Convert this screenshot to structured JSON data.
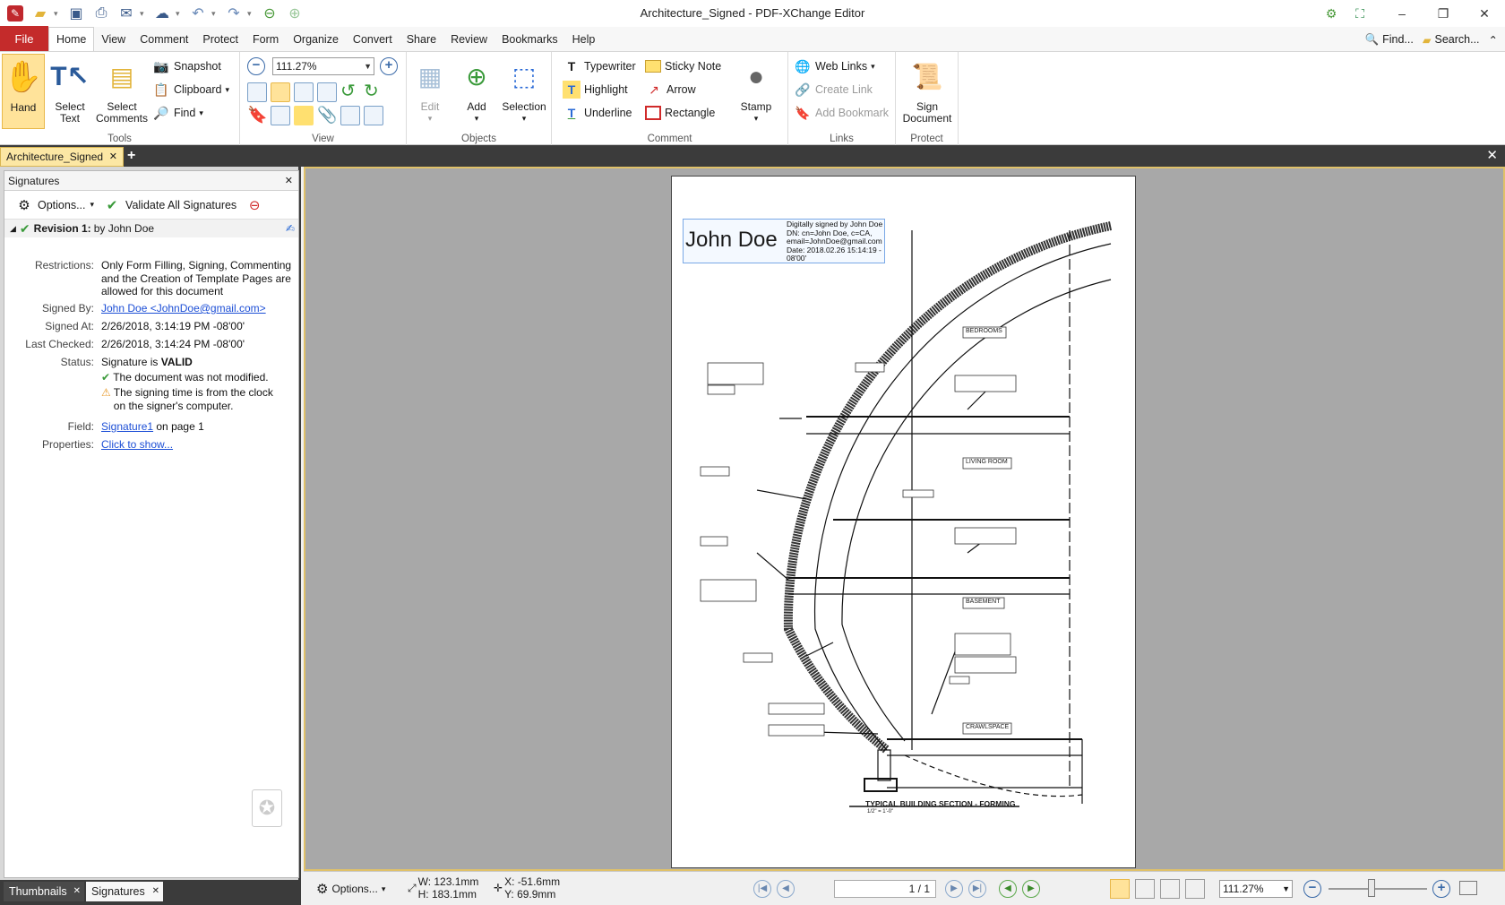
{
  "window": {
    "title": "Architecture_Signed - PDF-XChange Editor",
    "minimize": "–",
    "restore": "❐",
    "close": "✕"
  },
  "menu": {
    "file": "File",
    "tabs": [
      "Home",
      "View",
      "Comment",
      "Protect",
      "Form",
      "Organize",
      "Convert",
      "Share",
      "Review",
      "Bookmarks",
      "Help"
    ],
    "find": "Find...",
    "search": "Search..."
  },
  "ribbon": {
    "tools": {
      "label": "Tools",
      "hand": "Hand",
      "select_text": [
        "Select",
        "Text"
      ],
      "select_comments": [
        "Select",
        "Comments"
      ],
      "snapshot": "Snapshot",
      "clipboard": "Clipboard",
      "find": "Find"
    },
    "view": {
      "label": "View",
      "zoom": "111.27%"
    },
    "objects": {
      "label": "Objects",
      "edit": "Edit",
      "add": "Add",
      "selection": "Selection"
    },
    "comment": {
      "label": "Comment",
      "typewriter": "Typewriter",
      "sticky_note": "Sticky Note",
      "highlight": "Highlight",
      "arrow": "Arrow",
      "underline": "Underline",
      "rectangle": "Rectangle",
      "stamp": "Stamp"
    },
    "links": {
      "label": "Links",
      "web_links": "Web Links",
      "create_link": "Create Link",
      "add_bookmark": "Add Bookmark"
    },
    "protect": {
      "label": "Protect",
      "sign_document": [
        "Sign",
        "Document"
      ]
    }
  },
  "doc_tab": {
    "name": "Architecture_Signed"
  },
  "signatures_panel": {
    "title": "Signatures",
    "options": "Options...",
    "validate_all": "Validate All Signatures",
    "revision_label": "Revision 1:",
    "revision_by": "by John Doe",
    "restrictions_label": "Restrictions:",
    "restrictions_value": [
      "Only Form Filling, Signing, Commenting",
      "and the Creation of Template Pages are",
      "allowed for this document"
    ],
    "signed_by_label": "Signed By:",
    "signed_by_value": "John Doe <JohnDoe@gmail.com>",
    "signed_at_label": "Signed At:",
    "signed_at_value": "2/26/2018, 3:14:19 PM -08'00'",
    "last_checked_label": "Last Checked:",
    "last_checked_value": "2/26/2018, 3:14:24 PM -08'00'",
    "status_label": "Status:",
    "status_prefix": "Signature is ",
    "status_value": "VALID",
    "status_note1": "The document was not modified.",
    "status_note2": [
      "The signing time is from the clock",
      "on the signer's computer."
    ],
    "field_label": "Field:",
    "field_value": "Signature1",
    "field_suffix": " on page 1",
    "properties_label": "Properties:",
    "properties_value": "Click to show..."
  },
  "bottom_tabs": {
    "thumbnails": "Thumbnails",
    "signatures": "Signatures"
  },
  "document": {
    "signature": {
      "name": "John Doe",
      "info": [
        "Digitally signed by John Doe",
        "DN: cn=John Doe, c=CA,",
        "email=JohnDoe@gmail.com",
        "Date: 2018.02.26 15:14:19 -",
        "08'00'"
      ]
    },
    "drawing": {
      "rooms": [
        "BEDROOMS",
        "LIVING ROOM",
        "BASEMENT",
        "CRAWLSPACE"
      ],
      "title": "TYPICAL BUILDING SECTION - FORMING",
      "scale": "1/2\" = 1'-0\""
    }
  },
  "statusbar": {
    "options": "Options...",
    "w": "W: 123.1mm",
    "h": "H: 183.1mm",
    "x": "X:  -51.6mm",
    "y": "Y:   69.9mm",
    "page": "1 / 1",
    "zoom": "111.27%"
  },
  "colors": {
    "file_tab": "#c42b2b",
    "accent": "#ffe39a",
    "link": "#1d4fd6",
    "valid": "#3a9a3a"
  }
}
